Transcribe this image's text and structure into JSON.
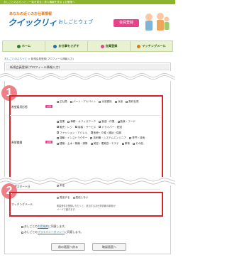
{
  "topbar": {
    "text": "おしごとのぷらっと | 一覧を見る | 求人情報を見る | 企業様へ"
  },
  "header": {
    "tagline": "あなたの近くのお仕事情報",
    "logo_main": "クイックリィ",
    "logo_sub": "おしごとウェブ",
    "free_badge": "会員登録"
  },
  "nav": {
    "items": [
      {
        "label": "ホーム",
        "icon": "home-icon",
        "color": "#2e7d32"
      },
      {
        "label": "お仕事をさがす",
        "icon": "search-icon",
        "color": "#1e72b8"
      },
      {
        "label": "会員登録",
        "icon": "user-icon",
        "color": "#e8428a"
      },
      {
        "label": "マッチングメール",
        "icon": "mail-icon",
        "color": "#e2780f"
      }
    ]
  },
  "breadcrumb": {
    "home": "おしごとのぷらっと",
    "sep": " > ",
    "current": "新規会員登録(プロフィール情報入力)"
  },
  "panel_title": "新規会員登録(プロフィール情報入力)",
  "section1": {
    "number": "1",
    "employment": {
      "label": "希望雇用形態",
      "required": "必須",
      "options": [
        "正社員",
        "パート・アルバイト",
        "派遣委託",
        "派遣",
        "契約社員"
      ]
    },
    "job": {
      "label": "希望職種",
      "required": "必須",
      "options": [
        "営業",
        "事務・オフィスワーク",
        "製造・作業",
        "飲食・フード",
        "販売・レジ",
        "接客・サービス",
        "ドライバー・配送",
        "ファッション・アパレル",
        "医療・介護・福祉・保育",
        "運輸・インストラクター",
        "技術職・システムエンジニア",
        "専門・技術",
        "建築・土木・警備・清掃",
        "美容・理美容・エステ",
        "教育",
        "その他"
      ]
    }
  },
  "start_row": {
    "label": "希望スタート日",
    "option": "未定"
  },
  "section2": {
    "number": "2",
    "label": "マッチングメール",
    "required": "必須",
    "options": [
      "受信する",
      "受信しない"
    ],
    "note1": "希望条件を登録いただくと、該当するお仕事情報の新着が",
    "note2": "メールで届きます。"
  },
  "consent": {
    "line1_pre": "おしごとの",
    "line1_link": "利用規約",
    "line1_post": "に同意します。",
    "line2_pre": "おしごとの",
    "line2_link": "プライバシーポリシー",
    "line2_post": "に同意します。"
  },
  "buttons": {
    "back": "前の画面へ戻る",
    "confirm": "確認画面へ"
  }
}
